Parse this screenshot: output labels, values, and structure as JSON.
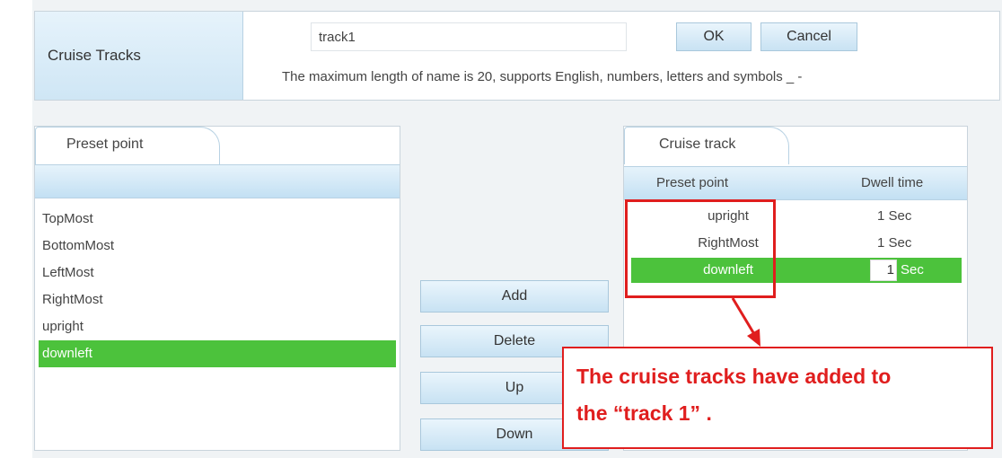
{
  "header": {
    "label": "Cruise Tracks",
    "name_value": "track1",
    "ok_label": "OK",
    "cancel_label": "Cancel",
    "hint": "The maximum length of name is 20, supports English, numbers, letters and symbols _ -"
  },
  "preset_panel": {
    "tab_label": "Preset point",
    "items": [
      "TopMost",
      "BottomMost",
      "LeftMost",
      "RightMost",
      "upright",
      "downleft"
    ],
    "selected_index": 5
  },
  "actions": {
    "add_label": "Add",
    "delete_label": "Delete",
    "up_label": "Up",
    "down_label": "Down"
  },
  "track_panel": {
    "tab_label": "Cruise track",
    "col_preset": "Preset point",
    "col_dwell": "Dwell time",
    "rows": [
      {
        "name": "upright",
        "dwell": "1",
        "unit": "Sec"
      },
      {
        "name": "RightMost",
        "dwell": "1",
        "unit": "Sec"
      },
      {
        "name": "downleft",
        "dwell": "1",
        "unit": "Sec"
      }
    ],
    "selected_index": 2
  },
  "annotation": {
    "line1": "The cruise tracks have added to",
    "line2": "the “track 1” ."
  },
  "colors": {
    "selection": "#4cc23c",
    "annotation": "#e01e1e",
    "bar": "#c3e0f3"
  }
}
